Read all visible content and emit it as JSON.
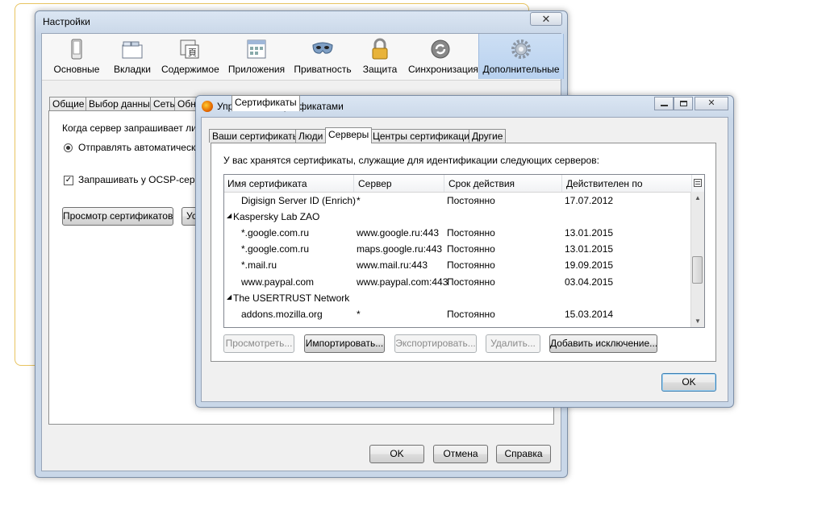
{
  "settings_window": {
    "title": "Настройки",
    "close_symbol": "✕",
    "toolbar": [
      {
        "label": "Основные",
        "icon": "general-icon"
      },
      {
        "label": "Вкладки",
        "icon": "tabs-icon"
      },
      {
        "label": "Содержимое",
        "icon": "content-icon"
      },
      {
        "label": "Приложения",
        "icon": "applications-icon"
      },
      {
        "label": "Приватность",
        "icon": "privacy-mask-icon"
      },
      {
        "label": "Защита",
        "icon": "padlock-icon"
      },
      {
        "label": "Синхронизация",
        "icon": "sync-icon"
      },
      {
        "label": "Дополнительные",
        "icon": "gear-icon",
        "active": true
      }
    ],
    "tabs": [
      "Общие",
      "Выбор данных",
      "Сеть",
      "Обновления",
      "Сертификаты"
    ],
    "active_tab": "Сертификаты",
    "server_request_text": "Когда сервер запрашивает личны",
    "radio_send_auto": "Отправлять автоматически",
    "checkbox_ocsp": "Запрашивать у OCSP-сервер",
    "view_certs_button": "Просмотр сертификатов",
    "devices_button_partial": "Ус",
    "ok_button": "OK",
    "cancel_button": "Отмена",
    "help_button": "Справка"
  },
  "cert_manager": {
    "title": "Управление сертификатами",
    "tabs": [
      "Ваши сертификаты",
      "Люди",
      "Серверы",
      "Центры сертификации",
      "Другие"
    ],
    "active_tab": "Серверы",
    "description": "У вас хранятся сертификаты, служащие для идентификации следующих серверов:",
    "columns": [
      "Имя сертификата",
      "Сервер",
      "Срок действия",
      "Действителен по"
    ],
    "rows": [
      {
        "type": "item",
        "name": "Digisign Server ID (Enrich)",
        "server": "*",
        "lifetime": "Постоянно",
        "expires": "17.07.2012"
      },
      {
        "type": "group",
        "name": "Kaspersky Lab ZAO"
      },
      {
        "type": "item",
        "name": "*.google.com.ru",
        "server": "www.google.ru:443",
        "lifetime": "Постоянно",
        "expires": "13.01.2015"
      },
      {
        "type": "item",
        "name": "*.google.com.ru",
        "server": "maps.google.ru:443",
        "lifetime": "Постоянно",
        "expires": "13.01.2015"
      },
      {
        "type": "item",
        "name": "*.mail.ru",
        "server": "www.mail.ru:443",
        "lifetime": "Постоянно",
        "expires": "19.09.2015"
      },
      {
        "type": "item",
        "name": "www.paypal.com",
        "server": "www.paypal.com:443",
        "lifetime": "Постоянно",
        "expires": "03.04.2015"
      },
      {
        "type": "group",
        "name": "The USERTRUST Network"
      },
      {
        "type": "item",
        "name": "addons.mozilla.org",
        "server": "*",
        "lifetime": "Постоянно",
        "expires": "15.03.2014"
      }
    ],
    "buttons": {
      "view": "Просмотреть...",
      "import": "Импортировать...",
      "export": "Экспортировать...",
      "delete": "Удалить...",
      "add_exception": "Добавить исключение..."
    },
    "ok_button": "OK"
  }
}
